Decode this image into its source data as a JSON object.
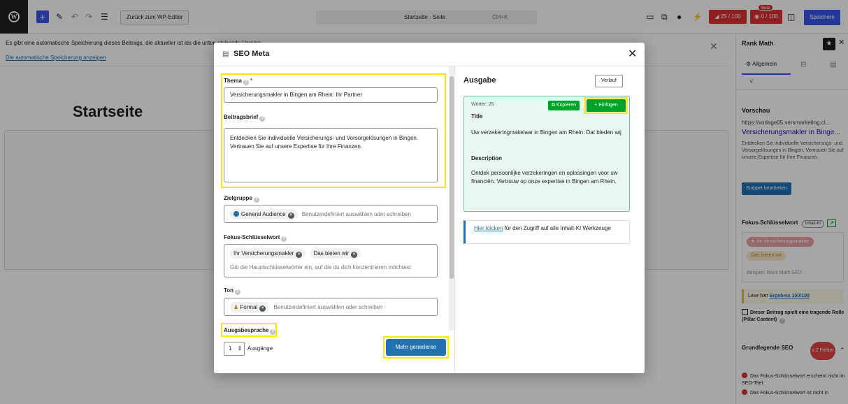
{
  "toolbar": {
    "back_label": "Zurück zum WP-Editor",
    "doc_title": "Startseite · Seite",
    "doc_shortcut": "Ctrl+K",
    "score_rankmath": "25 / 100",
    "score_content": "0 / 100",
    "score_content_badge": "Beta",
    "save_label": "Speichern"
  },
  "editor": {
    "notice_text": "Es gibt eine automatische Speicherung dieses Beitrags, die aktueller ist als die unten stehende Version.",
    "notice_link": "Die automatische Speicherung anzeigen",
    "page_title": "Startseite"
  },
  "sidebar": {
    "title": "Rank Math",
    "tab_general": "Allgemein",
    "preview_title": "Vorschau",
    "preview_url": "https://vorlage05.versmarketing.cl...",
    "preview_headline": "Versicherungsmakler in Binge...",
    "preview_desc": "Entdecken Sie individuelle Versicherungs- und Vorsorgelösungen in Bingen. Vertrauen Sie auf unsere Expertise für Ihre Finanzen.",
    "snippet_button": "Snippet bearbeiten",
    "focus_title": "Fokus-Schlüsselwort",
    "ki_badge": "Inhalt-KI",
    "focus_tags": [
      "Ihr Versicherungsmakler",
      "Das bieten wir"
    ],
    "focus_placeholder": "Beispiel: Rank Math SEO",
    "result_prefix": "Lese hier ",
    "result_link": "Ergebnis 100/100",
    "pillar_label": "Dieser Beitrag spielt eine tragende Rolle (Pillar Content)",
    "seo_basic": "Grundlegende SEO",
    "seo_errors": "x 2 Fehler",
    "errors": [
      "Das Fokus-Schlüsselwort erscheint nicht im SEO-Titel.",
      "Das Fokus-Schlüsselwort ist nicht in"
    ]
  },
  "modal": {
    "title": "SEO Meta",
    "fields": {
      "topic_label": "Thema",
      "topic_value": "Versicherungsmakler in Bingen am Rhein: Ihr Partner",
      "brief_label": "Beitragsbrief",
      "brief_value": "Entdecken Sie individuelle Versicherungs- und Vorsorgelösungen in Bingen. Vertrauen Sie auf unsere Expertise für Ihre Finanzen.",
      "audience_label": "Zielgruppe",
      "audience_tag": "General Audience",
      "audience_placeholder": "Benutzerdefiniert auswählen oder schreiben",
      "keyword_label": "Fokus-Schlüsselwort",
      "keyword_tags": [
        "Ihr Versicherungsmakler",
        "Das bieten wir"
      ],
      "keyword_placeholder": "Gib die Hauptschlüsselwörter ein, auf die du dich konzentrieren möchtest",
      "tone_label": "Ton",
      "tone_tag": "Formal",
      "tone_placeholder": "Benutzerdefiniert auswählen oder schreiben",
      "language_label": "Ausgabesprache"
    },
    "outputs_count": "1",
    "outputs_label": "Ausgänge",
    "generate_button": "Mehr generieren",
    "output": {
      "heading": "Ausgabe",
      "history_button": "Verlauf",
      "words": "Wörter: 25",
      "copy_button": "Kopieren",
      "insert_button": "+ Einfügen",
      "title_label": "Title",
      "title_text": "Uw verzekeringmakelaar in Bingen am Rhein: Dat bieden wij",
      "desc_label": "Description",
      "desc_text": "Ontdek persoonlijke verzekeringen en oplossingen voor uw financiën. Vertrouw op onze expertise in Bingen am Rhein.",
      "ki_link": "Hier klicken",
      "ki_text": " für den Zugriff auf alle Inhalt-KI Werkzeuge"
    }
  }
}
